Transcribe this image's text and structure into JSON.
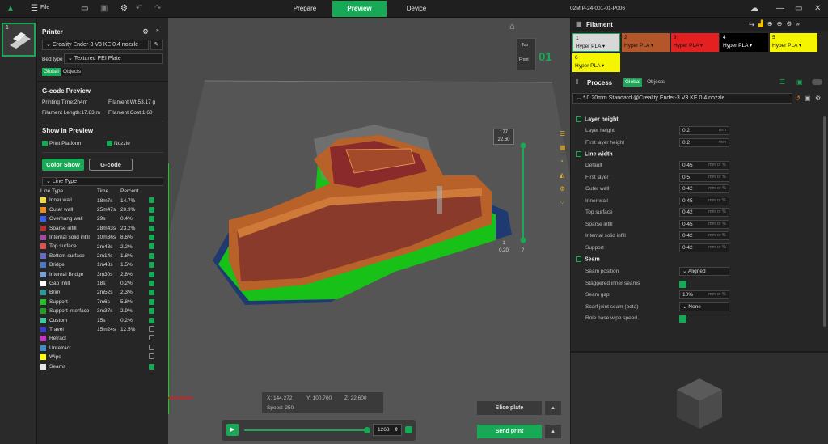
{
  "topbar": {
    "file_label": "File",
    "tabs": [
      {
        "label": "Prepare"
      },
      {
        "label": "Preview"
      },
      {
        "label": "Device"
      }
    ],
    "active_tab": "Preview",
    "job_name": "02MIP-24-001-01-P006"
  },
  "plate_thumb": {
    "index": "1"
  },
  "printer": {
    "section_title": "Printer",
    "printer_name": "Creality Ender-3 V3 KE 0.4 nozzle",
    "bed_type_label": "Bed type",
    "bed_type_value": "Textured PEI Plate",
    "scope_tabs": [
      "Global",
      "Objects"
    ]
  },
  "gcode_preview": {
    "title": "G-code Preview",
    "printing_time": "Printing Time:2h4m",
    "filament_wt": "Filament Wt:53.17 g",
    "filament_length": "Filament Length:17.83 m",
    "filament_cost": "Filament Cost:1.60",
    "show_title": "Show in Preview",
    "print_platform": "Print Platform",
    "nozzle": "Nozzle",
    "color_show": "Color Show",
    "gcode": "G-code",
    "line_type_select": "Line Type",
    "col_line_type": "Line Type",
    "col_time": "Time",
    "col_percent": "Percent",
    "rows": [
      {
        "name": "Inner wall",
        "time": "18m7s",
        "percent": "14.7%",
        "color": "#f2dc3c",
        "checked": true
      },
      {
        "name": "Outer wall",
        "time": "25m47s",
        "percent": "20.9%",
        "color": "#f08c1e",
        "checked": true
      },
      {
        "name": "Overhang wall",
        "time": "29s",
        "percent": "0.4%",
        "color": "#3a5ef0",
        "checked": true
      },
      {
        "name": "Sparse infill",
        "time": "28m43s",
        "percent": "23.2%",
        "color": "#b43232",
        "checked": true
      },
      {
        "name": "Internal solid infill",
        "time": "10m36s",
        "percent": "8.6%",
        "color": "#a04ca0",
        "checked": true
      },
      {
        "name": "Top surface",
        "time": "2m43s",
        "percent": "2.2%",
        "color": "#e05050",
        "checked": true
      },
      {
        "name": "Bottom surface",
        "time": "2m14s",
        "percent": "1.8%",
        "color": "#6a6ac8",
        "checked": true
      },
      {
        "name": "Bridge",
        "time": "1m48s",
        "percent": "1.5%",
        "color": "#4c78c8",
        "checked": true
      },
      {
        "name": "Internal Bridge",
        "time": "3m30s",
        "percent": "2.8%",
        "color": "#78a0d8",
        "checked": true
      },
      {
        "name": "Gap infill",
        "time": "18s",
        "percent": "0.2%",
        "color": "#ffffff",
        "checked": true
      },
      {
        "name": "Brim",
        "time": "2m52s",
        "percent": "2.3%",
        "color": "#2a9a9a",
        "checked": true
      },
      {
        "name": "Support",
        "time": "7m6s",
        "percent": "5.8%",
        "color": "#1ec81e",
        "checked": true
      },
      {
        "name": "Support interface",
        "time": "3m37s",
        "percent": "2.9%",
        "color": "#22a022",
        "checked": true
      },
      {
        "name": "Custom",
        "time": "15s",
        "percent": "0.2%",
        "color": "#3cc8a0",
        "checked": true
      },
      {
        "name": "Travel",
        "time": "15m24s",
        "percent": "12.5%",
        "color": "#3a3ad0",
        "checked": false
      },
      {
        "name": "Retract",
        "time": "",
        "percent": "",
        "color": "#c832c8",
        "checked": false
      },
      {
        "name": "Unretract",
        "time": "",
        "percent": "",
        "color": "#3c8cc8",
        "checked": false
      },
      {
        "name": "Wipe",
        "time": "",
        "percent": "",
        "color": "#ffff00",
        "checked": false
      },
      {
        "name": "Seams",
        "time": "",
        "percent": "",
        "color": "#e6e6e6",
        "checked": true
      }
    ]
  },
  "viewport": {
    "cube_top": "Top",
    "cube_front": "Front",
    "plate_number": "01",
    "layer_top_count": "177",
    "layer_top_height": "22.60",
    "layer_bottom_count": "1",
    "layer_bottom_height": "0.20",
    "help": "?",
    "coord_x": "X: 144.272",
    "coord_y": "Y: 100.700",
    "coord_z": "Z: 22.600",
    "speed": "Speed: 250",
    "layer_index": "1263",
    "slice_plate": "Slice plate",
    "send_print": "Send print",
    "collapse": "<<"
  },
  "filament": {
    "title": "Filament",
    "slots": [
      {
        "num": "1",
        "name": "Hyper PLA",
        "bg": "#d8d8d8",
        "fg": "#111111"
      },
      {
        "num": "2",
        "name": "Hyper PLA",
        "bg": "#b4552a",
        "fg": "#111111"
      },
      {
        "num": "3",
        "name": "Hyper PLA",
        "bg": "#e52020",
        "fg": "#111111"
      },
      {
        "num": "4",
        "name": "Hyper PLA",
        "bg": "#000000",
        "fg": "#ffffff"
      },
      {
        "num": "5",
        "name": "Hyper PLA",
        "bg": "#f5f500",
        "fg": "#111111"
      },
      {
        "num": "6",
        "name": "Hyper PLA",
        "bg": "#f5f500",
        "fg": "#111111"
      }
    ]
  },
  "process": {
    "title": "Process",
    "scope_tabs": [
      "Global",
      "Objects"
    ],
    "preset": "* 0.20mm Standard @Creality Ender-3 V3 KE 0.4 nozzle",
    "groups": [
      {
        "title": "Layer height",
        "rows": [
          {
            "label": "Layer height",
            "value": "0.2",
            "unit": "mm"
          },
          {
            "label": "First layer height",
            "value": "0.2",
            "unit": "mm"
          }
        ]
      },
      {
        "title": "Line width",
        "rows": [
          {
            "label": "Default",
            "value": "0.45",
            "unit": "mm or %"
          },
          {
            "label": "First layer",
            "value": "0.5",
            "unit": "mm or %"
          },
          {
            "label": "Outer wall",
            "value": "0.42",
            "unit": "mm or %"
          },
          {
            "label": "Inner wall",
            "value": "0.45",
            "unit": "mm or %"
          },
          {
            "label": "Top surface",
            "value": "0.42",
            "unit": "mm or %"
          },
          {
            "label": "Sparse infill",
            "value": "0.45",
            "unit": "mm or %"
          },
          {
            "label": "Internal solid infill",
            "value": "0.42",
            "unit": "mm or %"
          },
          {
            "label": "Support",
            "value": "0.42",
            "unit": "mm or %"
          }
        ]
      }
    ],
    "seam_title": "Seam",
    "seam_position_label": "Seam position",
    "seam_position_value": "Aligned",
    "staggered_label": "Staggered inner seams",
    "seam_gap_label": "Seam gap",
    "seam_gap_value": "10%",
    "seam_gap_unit": "mm or %",
    "scarf_label": "Scarf joint seam (beta)",
    "scarf_value": "None",
    "wipe_label": "Role base wipe speed"
  }
}
